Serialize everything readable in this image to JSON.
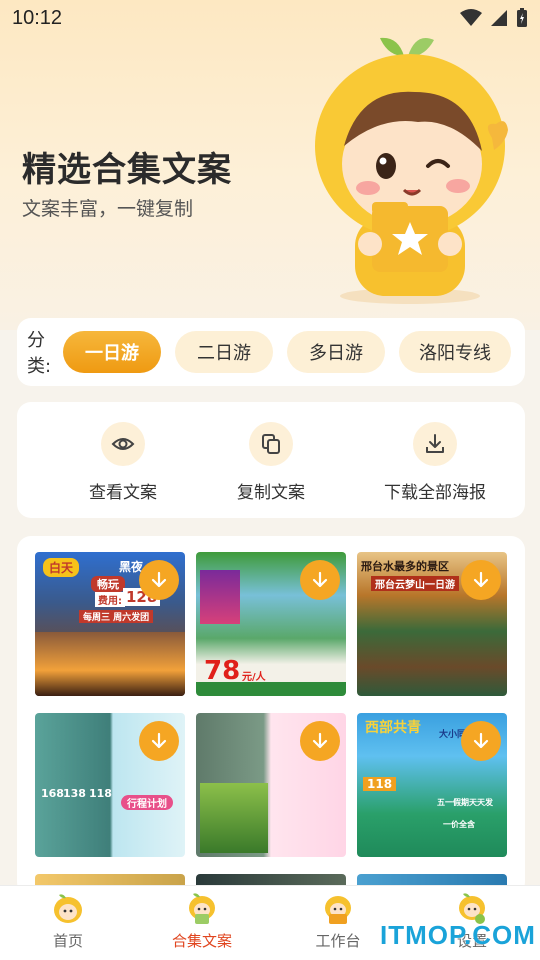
{
  "status": {
    "time": "10:12"
  },
  "hero": {
    "title": "精选合集文案",
    "subtitle": "文案丰富，一键复制"
  },
  "categories": {
    "label": "分类:",
    "items": [
      "一日游",
      "二日游",
      "多日游",
      "洛阳专线"
    ],
    "selected": "一日游"
  },
  "actions": {
    "view": "查看文案",
    "copy": "复制文案",
    "download": "下载全部海报"
  },
  "posters": [
    {
      "lines": [
        "白天",
        "黑夜",
        "畅玩",
        "费用:",
        "128",
        "每周三 周六发团"
      ]
    },
    {
      "lines": [
        "78",
        "元/人"
      ]
    },
    {
      "lines": [
        "邢台水最多的景区",
        "邢台云梦山一日游"
      ]
    },
    {
      "lines": [
        "168",
        "138",
        "118",
        "行程计划"
      ]
    },
    {
      "lines": []
    },
    {
      "lines": [
        "西部共青",
        "大小同游",
        "118",
        "五一假期天天发",
        "一价全含"
      ]
    }
  ],
  "nav": {
    "items": [
      "首页",
      "合集文案",
      "工作台",
      "设置"
    ],
    "active": "合集文案"
  },
  "watermark": "ITMOP.COM",
  "colors": {
    "accent": "#F5A623",
    "active_nav": "#E0451F"
  }
}
